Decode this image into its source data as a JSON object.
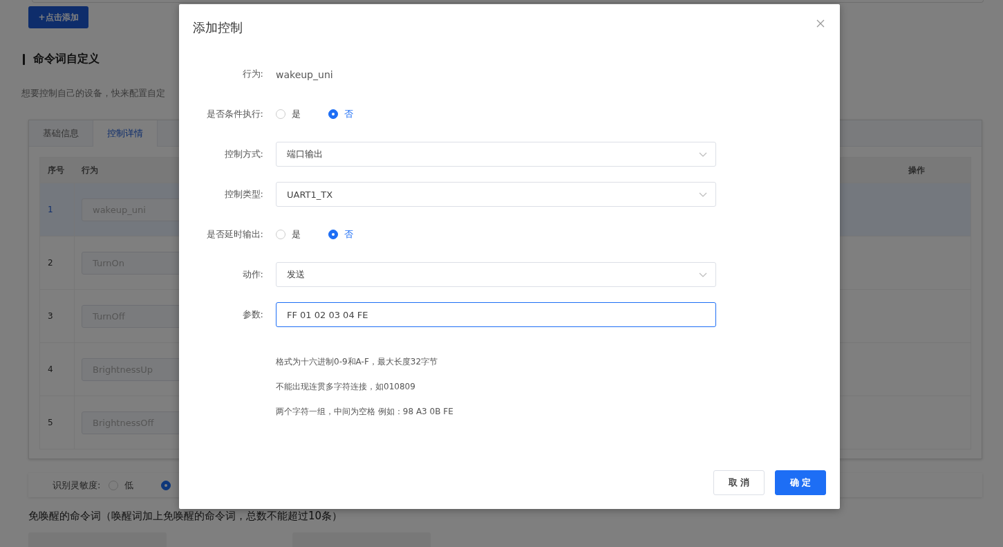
{
  "page": {
    "add_button": "+点击添加",
    "section_title": "命令词自定义",
    "description": "想要控制自己的设备，快来配置自定",
    "tabs": [
      {
        "label": "基础信息",
        "selected": false
      },
      {
        "label": "控制详情",
        "selected": true
      }
    ],
    "table": {
      "columns": [
        "序号",
        "行为",
        "操作"
      ],
      "rows": [
        {
          "index": "1",
          "behavior": "wakeup_uni",
          "selected": true
        },
        {
          "index": "2",
          "behavior": "TurnOn",
          "selected": false
        },
        {
          "index": "3",
          "behavior": "TurnOff",
          "selected": false
        },
        {
          "index": "4",
          "behavior": "BrightnessUp",
          "selected": false
        },
        {
          "index": "5",
          "behavior": "BrightnessOff",
          "selected": false
        }
      ]
    },
    "sensitivity": {
      "label": "识别灵敏度:",
      "options": [
        {
          "label": "低",
          "selected": false
        },
        {
          "selected": true
        }
      ]
    },
    "wake_free_title": "免唤醒的命令词（唤醒词加上免唤醒的命令词，总数不能超过10条）"
  },
  "dialog": {
    "title": "添加控制",
    "fields": [
      {
        "kind": "text",
        "label": "行为:",
        "value": "wakeup_uni"
      },
      {
        "kind": "radio",
        "label": "是否条件执行:",
        "options": [
          {
            "label": "是",
            "selected": false
          },
          {
            "label": "否",
            "selected": true
          }
        ]
      },
      {
        "kind": "select",
        "label": "控制方式:",
        "value": "端口输出"
      },
      {
        "kind": "select",
        "label": "控制类型:",
        "value": "UART1_TX"
      },
      {
        "kind": "radio",
        "label": "是否延时输出:",
        "options": [
          {
            "label": "是",
            "selected": false
          },
          {
            "label": "否",
            "selected": true
          }
        ]
      },
      {
        "kind": "select",
        "label": "动作:",
        "value": "发送"
      },
      {
        "kind": "input",
        "label": "参数:",
        "value": "FF 01 02 03 04 FE",
        "focused": true
      }
    ],
    "hints": [
      "格式为十六进制0-9和A-F，最大长度32字节",
      "不能出现连贯多字符连接，如010809",
      "两个字符一组，中间为空格 例如：98 A3 0B FE"
    ],
    "buttons": [
      {
        "kind": "default",
        "label": "取 消"
      },
      {
        "kind": "primary",
        "label": "确 定"
      }
    ]
  }
}
